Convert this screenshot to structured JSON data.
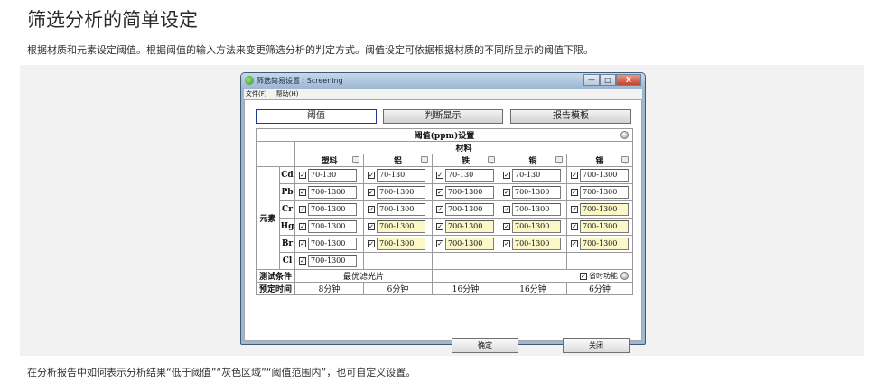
{
  "page": {
    "title": "筛选分析的简单设定",
    "description": "根据材质和元素设定阈值。根据阈值的输入方法来变更筛选分析的判定方式。阈值设定可依据根据材质的不同所显示的阈值下限。",
    "footer": "在分析报告中如何表示分析结果“低于阈值”“灰色区域”“阈值范围内”，也可自定义设置。"
  },
  "window": {
    "title": "筛选简易设置 : Screening",
    "controls": {
      "minimize": "—",
      "maximize": "□",
      "close": "X"
    },
    "menu": [
      "文件(F)",
      "帮助(H)"
    ],
    "tabs": [
      "阈值",
      "判断显示",
      "报告模板"
    ],
    "section_title": "阈值(ppm)设置",
    "material_header": "材料",
    "materials": [
      "塑料",
      "铝",
      "铁",
      "铜",
      "锡"
    ],
    "element_group_label": "元素",
    "rows": [
      {
        "element": "Cd",
        "values": [
          "70-130",
          "70-130",
          "70-130",
          "70-130",
          "700-1300"
        ],
        "highlight": [
          false,
          false,
          false,
          false,
          false
        ]
      },
      {
        "element": "Pb",
        "values": [
          "700-1300",
          "700-1300",
          "700-1300",
          "700-1300",
          "700-1300"
        ],
        "highlight": [
          false,
          false,
          false,
          false,
          false
        ]
      },
      {
        "element": "Cr",
        "values": [
          "700-1300",
          "700-1300",
          "700-1300",
          "700-1300",
          "700-1300"
        ],
        "highlight": [
          false,
          false,
          false,
          false,
          true
        ]
      },
      {
        "element": "Hg",
        "values": [
          "700-1300",
          "700-1300",
          "700-1300",
          "700-1300",
          "700-1300"
        ],
        "highlight": [
          false,
          true,
          true,
          true,
          true
        ]
      },
      {
        "element": "Br",
        "values": [
          "700-1300",
          "700-1300",
          "700-1300",
          "700-1300",
          "700-1300"
        ],
        "highlight": [
          false,
          true,
          true,
          true,
          true
        ]
      },
      {
        "element": "Cl",
        "values": [
          "700-1300",
          "",
          "",
          "",
          ""
        ],
        "highlight": [
          false,
          false,
          false,
          false,
          false
        ]
      }
    ],
    "test_conditions_label": "测试条件",
    "test_conditions_value": "最优滤光片",
    "time_saving_label": "省时功能",
    "scheduled_time_label": "预定时间",
    "scheduled_times": [
      "8分钟",
      "6分钟",
      "16分钟",
      "16分钟",
      "6分钟"
    ],
    "ok_button": "确定",
    "close_button": "关闭",
    "checkbox_mark": "✓"
  },
  "colors": {
    "highlight": "#fbf7c6",
    "active_tab_border": "#1d3b8f",
    "window_frame": "#9fb8cf"
  }
}
